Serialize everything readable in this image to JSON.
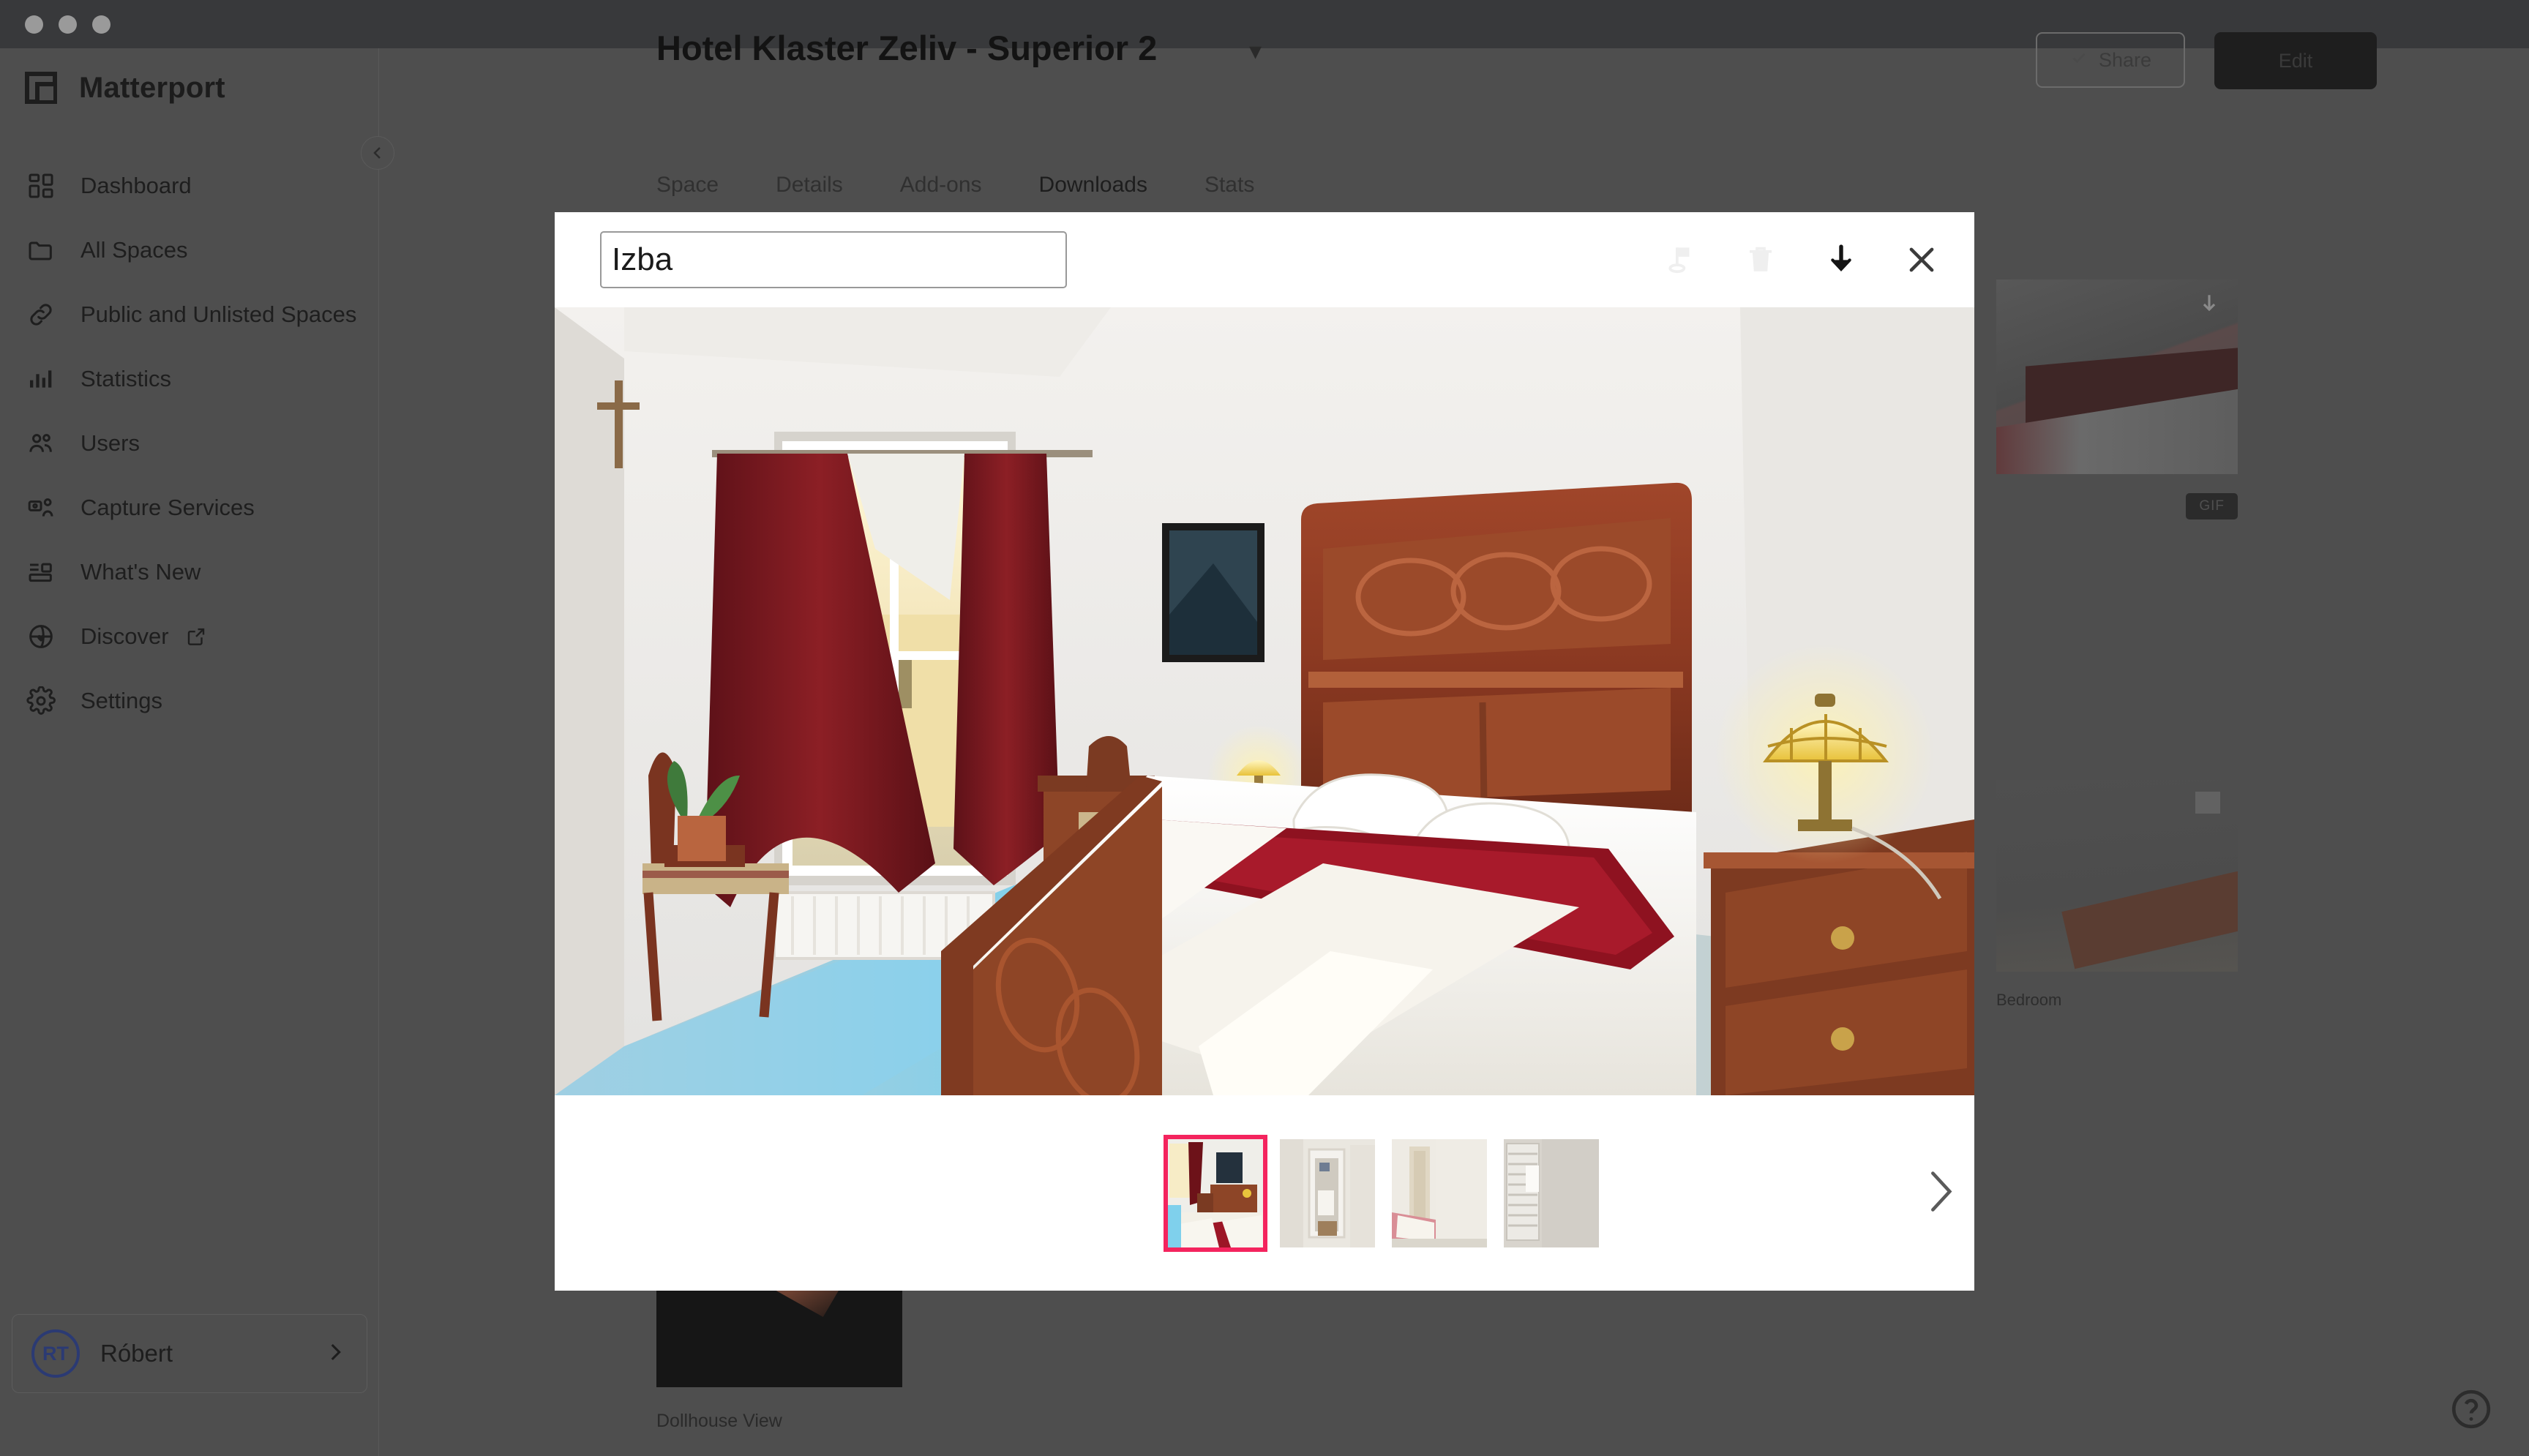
{
  "window": {
    "traffic_lights": [
      "close",
      "minimize",
      "maximize"
    ]
  },
  "sidebar": {
    "brand": "Matterport",
    "collapse_icon": "chevron-left-icon",
    "items": [
      {
        "label": "Dashboard",
        "icon": "grid-icon"
      },
      {
        "label": "All Spaces",
        "icon": "folder-icon"
      },
      {
        "label": "Public and Unlisted Spaces",
        "icon": "link-icon"
      },
      {
        "label": "Statistics",
        "icon": "bar-chart-icon"
      },
      {
        "label": "Users",
        "icon": "users-icon"
      },
      {
        "label": "Capture Services",
        "icon": "camera-person-icon"
      },
      {
        "label": "What's New",
        "icon": "news-icon"
      },
      {
        "label": "Discover",
        "icon": "globe-heart-icon",
        "external": true
      },
      {
        "label": "Settings",
        "icon": "gear-icon"
      }
    ],
    "user": {
      "initials": "RT",
      "name": "Róbert",
      "chevron": "chevron-right-icon"
    }
  },
  "page": {
    "title": "Hotel Klaster Zeliv - Superior 2",
    "title_caret": "chevron-down-icon",
    "share_label": "Share",
    "share_icon": "check-icon",
    "edit_label": "Edit",
    "tabs": [
      {
        "label": "Space",
        "active": false
      },
      {
        "label": "Details",
        "active": false
      },
      {
        "label": "Add-ons",
        "active": false
      },
      {
        "label": "Downloads",
        "active": true
      },
      {
        "label": "Stats",
        "active": false
      }
    ],
    "dollhouse_label": "Dollhouse View",
    "card_a_badge": "GIF",
    "card_a_icon": "download-icon",
    "card_b_label": "Bedroom",
    "card_b_icon": "square-icon",
    "next_chevron_icon": "chevron-right-icon",
    "help_icon": "help-circle-icon"
  },
  "modal": {
    "title_value": "Izba",
    "title_placeholder": "Name",
    "actions": [
      {
        "name": "tag-icon",
        "label": "Tag",
        "disabled": true
      },
      {
        "name": "trash-icon",
        "label": "Delete",
        "disabled": true
      },
      {
        "name": "download-icon",
        "label": "Download",
        "disabled": false
      },
      {
        "name": "close-icon",
        "label": "Close",
        "disabled": false
      }
    ],
    "hero_alt": "Hotel bedroom with carved wooden bed, red throw, tall window with burgundy curtains",
    "thumbnails": [
      {
        "alt": "Bedroom with red throw",
        "selected": true
      },
      {
        "alt": "Hallway to bathroom",
        "selected": false
      },
      {
        "alt": "Bedroom with pink bedspread",
        "selected": false
      },
      {
        "alt": "Bathroom with towel radiator",
        "selected": false
      }
    ],
    "next_chevron_icon": "chevron-right-icon"
  },
  "colors": {
    "accent_pink": "#f4245e",
    "modal_bg": "#ffffff",
    "overlay": "rgba(0,0,0,0.42)",
    "avatar_border": "#2b3a73"
  }
}
